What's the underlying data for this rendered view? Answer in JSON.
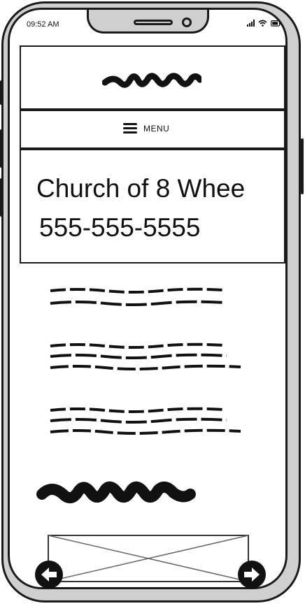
{
  "status_bar": {
    "time": "09:52 AM"
  },
  "nav": {
    "menu_label": "MENU"
  },
  "hero": {
    "title": "Church of 8 Whee",
    "phone": "555-555-5555"
  },
  "icons": [
    "hamburger-icon",
    "signal-icon",
    "wifi-icon",
    "battery-icon",
    "arrow-left-icon",
    "arrow-right-icon"
  ],
  "colors": {
    "ink": "#111111",
    "frame": "#cfcfcf",
    "screen": "#ffffff"
  }
}
